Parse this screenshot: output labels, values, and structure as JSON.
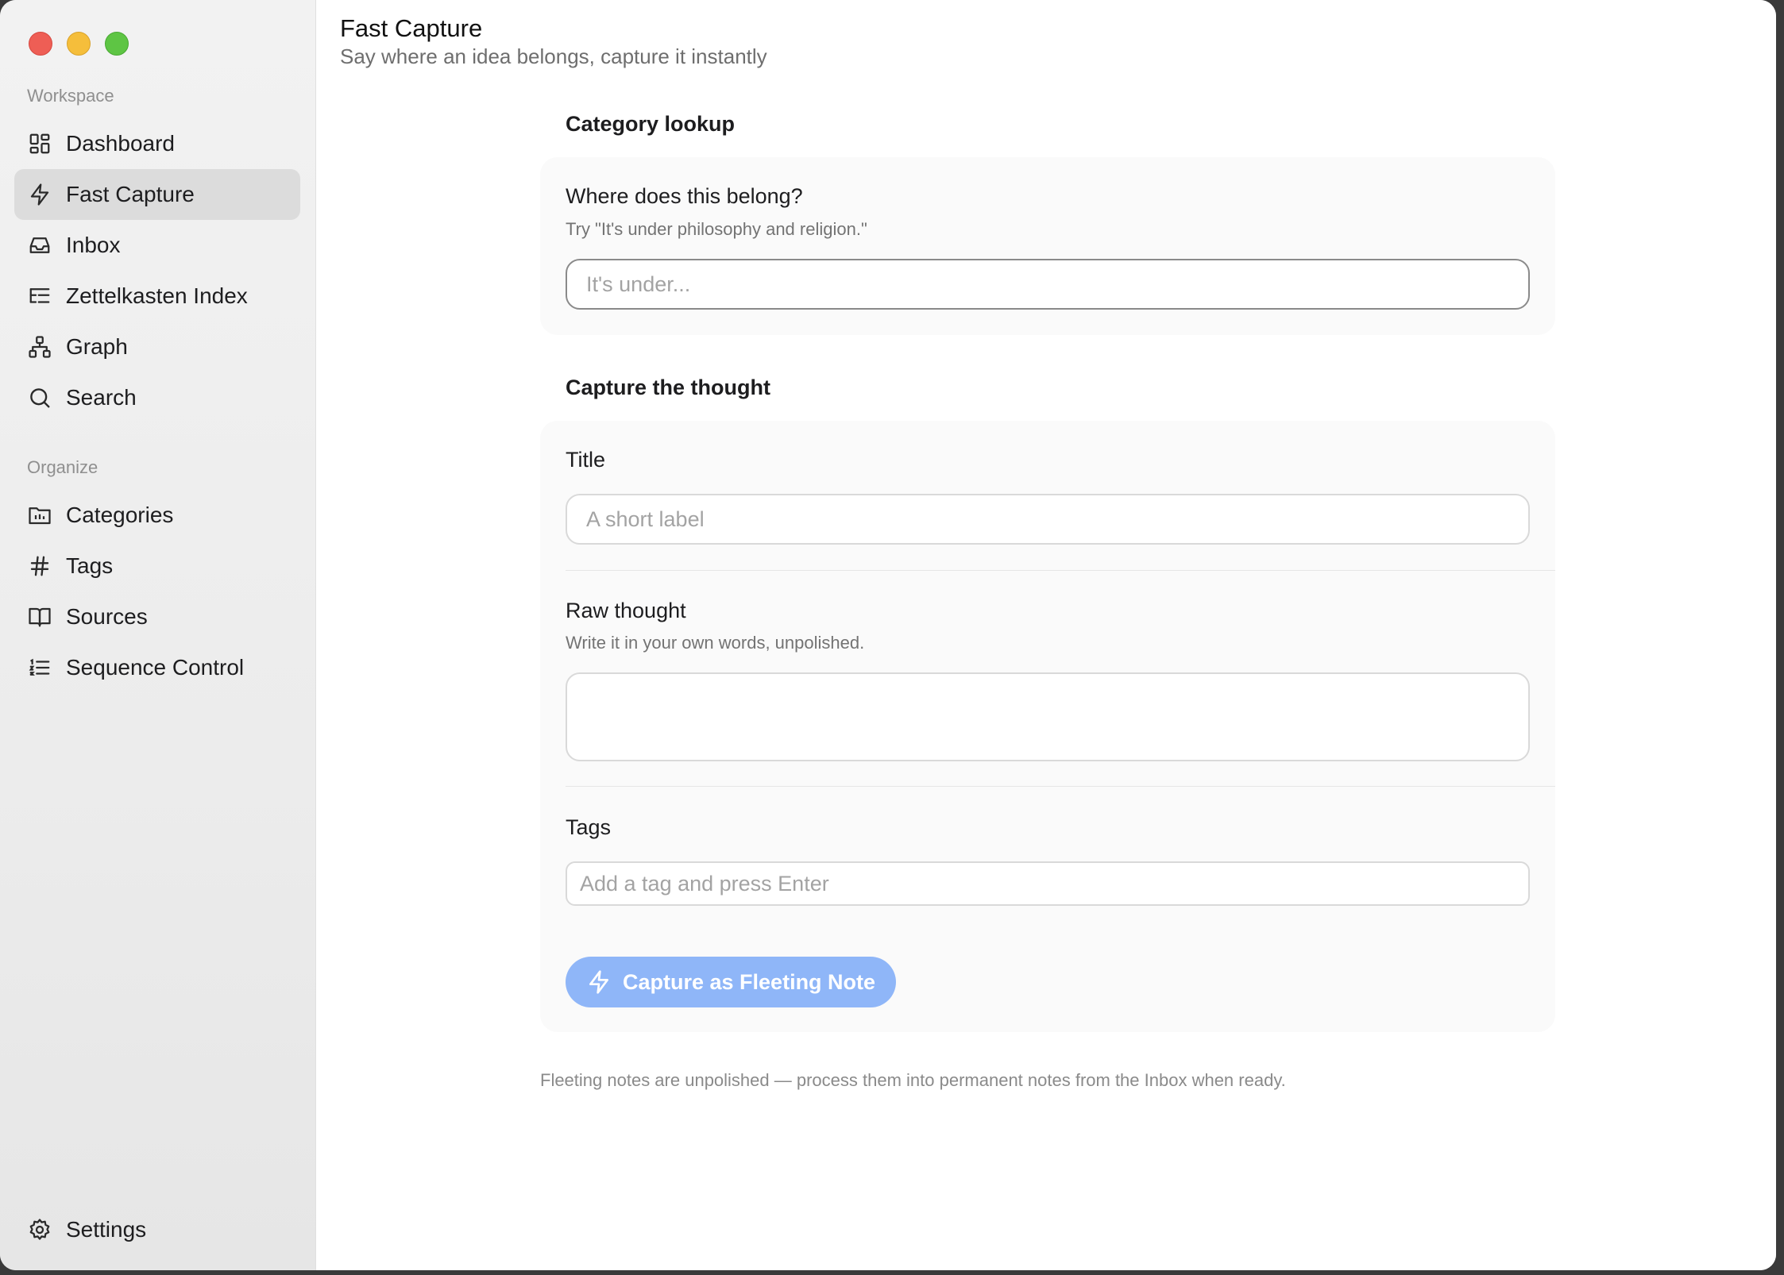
{
  "sidebar": {
    "workspace_label": "Workspace",
    "organize_label": "Organize",
    "workspace_items": [
      {
        "label": "Dashboard",
        "icon": "dashboard-icon"
      },
      {
        "label": "Fast Capture",
        "icon": "bolt-icon",
        "active": true
      },
      {
        "label": "Inbox",
        "icon": "inbox-icon"
      },
      {
        "label": "Zettelkasten Index",
        "icon": "index-list-icon"
      },
      {
        "label": "Graph",
        "icon": "graph-icon"
      },
      {
        "label": "Search",
        "icon": "search-icon"
      }
    ],
    "organize_items": [
      {
        "label": "Categories",
        "icon": "folder-icon"
      },
      {
        "label": "Tags",
        "icon": "hash-icon"
      },
      {
        "label": "Sources",
        "icon": "book-icon"
      },
      {
        "label": "Sequence Control",
        "icon": "numbered-list-icon"
      }
    ],
    "settings_label": "Settings"
  },
  "header": {
    "title": "Fast Capture",
    "subtitle": "Say where an idea belongs, capture it instantly"
  },
  "category_lookup": {
    "heading": "Category lookup",
    "question": "Where does this belong?",
    "hint": "Try \"It's under philosophy and religion.\"",
    "placeholder": "It's under...",
    "value": ""
  },
  "capture": {
    "heading": "Capture the thought",
    "title_label": "Title",
    "title_placeholder": "A short label",
    "raw_label": "Raw thought",
    "raw_hint": "Write it in your own words, unpolished.",
    "raw_value": "",
    "tags_label": "Tags",
    "tags_placeholder": "Add a tag and press Enter",
    "button_label": "Capture as Fleeting Note"
  },
  "footnote": "Fleeting notes are unpolished — process them into permanent notes from the Inbox when ready.",
  "colors": {
    "accent_button": "#8fb6f8",
    "active_nav": "#dcdcdc",
    "sidebar_bg": "#f0f0f0"
  }
}
